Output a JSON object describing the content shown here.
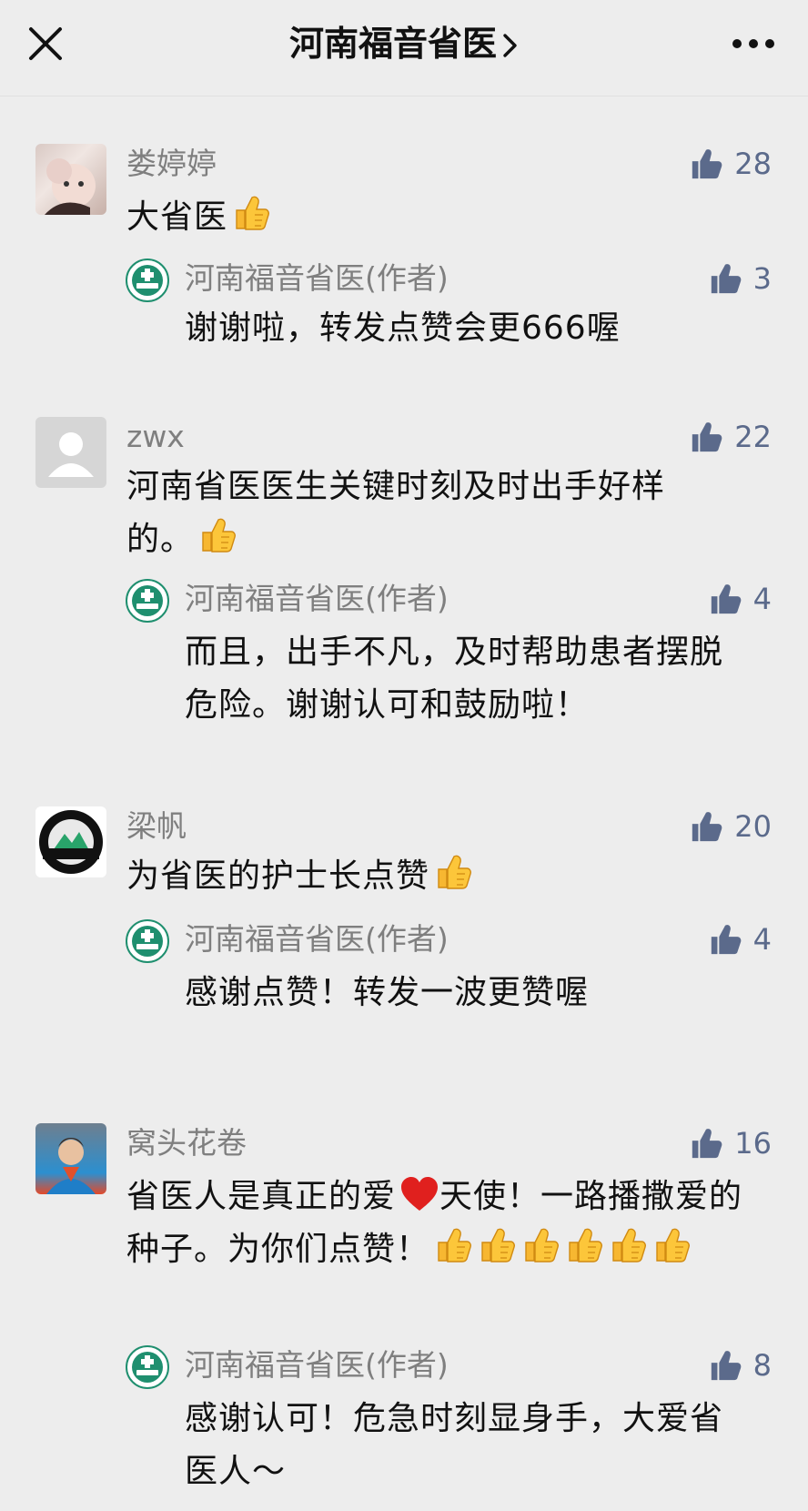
{
  "header": {
    "title": "河南福音省医",
    "close_icon": "close-icon",
    "more_icon": "more-icon",
    "chevron_icon": "chevron-right-icon"
  },
  "colors": {
    "background": "#ededed",
    "name_gray": "#7f7f7f",
    "like_blue": "#5b6a8b",
    "logo_green": "#1f8f6f"
  },
  "comments": [
    {
      "name": "娄婷婷",
      "text": "大省医",
      "emoji_count": 1,
      "likes": "28",
      "reply": {
        "name": "河南福音省医(作者)",
        "text": "谢谢啦，转发点赞会更666喔",
        "likes": "3"
      }
    },
    {
      "name": "zwx",
      "text": "河南省医医生关键时刻及时出手好样的。",
      "emoji_count": 1,
      "likes": "22",
      "reply": {
        "name": "河南福音省医(作者)",
        "text": "而且，出手不凡，及时帮助患者摆脱危险。谢谢认可和鼓励啦！",
        "likes": "4"
      }
    },
    {
      "name": "梁帆",
      "text": "为省医的护士长点赞",
      "emoji_count": 1,
      "likes": "20",
      "reply": {
        "name": "河南福音省医(作者)",
        "text": "感谢点赞！转发一波更赞喔",
        "likes": "4"
      }
    },
    {
      "name": "窝头花卷",
      "text_a": "省医人是真正的爱",
      "text_b": "天使！一路播撒爱的种子。为你们点赞！",
      "emoji_count": 6,
      "likes": "16",
      "reply": {
        "name": "河南福音省医(作者)",
        "text": "感谢认可！危急时刻显身手，大爱省医人～",
        "likes": "8"
      }
    }
  ]
}
